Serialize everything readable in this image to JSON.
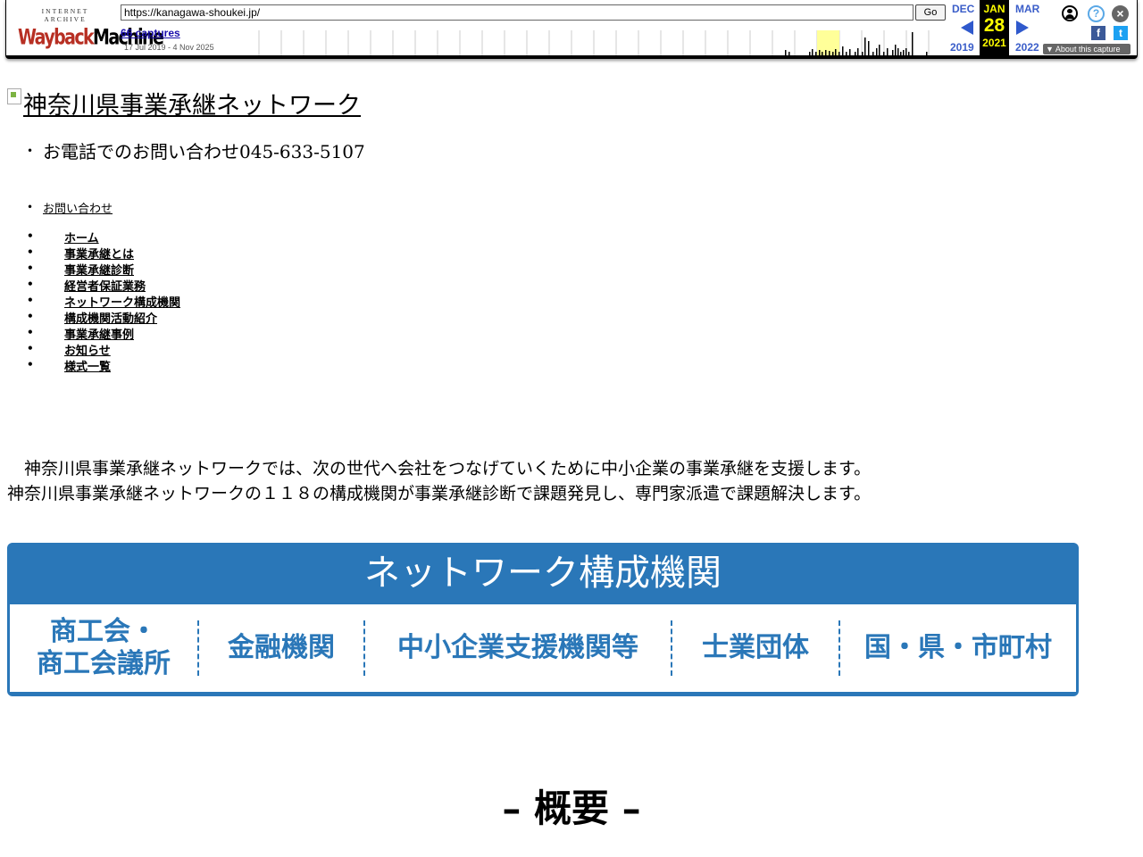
{
  "wayback": {
    "logo_top": "INTERNET ARCHIVE",
    "logo_way": "Wayback",
    "logo_mach": "Machine",
    "url": "https://kanagawa-shoukei.jp/",
    "go_label": "Go",
    "captures_label": "66 captures",
    "range_label": "17 Jul 2019 - 4 Nov 2025",
    "prev_month": "DEC",
    "prev_year": "2019",
    "cur_month": "JAN",
    "cur_day": "28",
    "cur_year": "2021",
    "next_month": "MAR",
    "next_year": "2022",
    "about_label": "About this capture",
    "help_glyph": "?",
    "close_glyph": "×",
    "fb_glyph": "f",
    "tw_glyph": "t",
    "accent_color": "#2f59cc",
    "highlight_color": "#ffff00"
  },
  "site": {
    "logo_alt": "神奈川県事業承継ネットワーク",
    "phone_label": "お電話でのお問い合わせ045-633-5107",
    "contact_label": "お問い合わせ",
    "nav": [
      "ホーム",
      "事業承継とは",
      "事業承継診断",
      "経営者保証業務",
      "ネットワーク構成機関",
      "構成機関活動紹介",
      "事業承継事例",
      "お知らせ",
      "様式一覧"
    ],
    "intro_line1": "　神奈川県事業承継ネットワークでは、次の世代へ会社をつなげていくために中小企業の事業承継を支援します。",
    "intro_line2": "神奈川県事業承継ネットワークの１１８の構成機関が事業承継診断で課題発見し、専門家派遣で課題解決します。",
    "network": {
      "title": "ネットワーク構成機関",
      "categories": [
        "商工会・\n商工会議所",
        "金融機関",
        "中小企業支援機関等",
        "士業団体",
        "国・県・市町村"
      ],
      "brand_color": "#2a77b8"
    },
    "overview_heading": "– 概要 –"
  }
}
